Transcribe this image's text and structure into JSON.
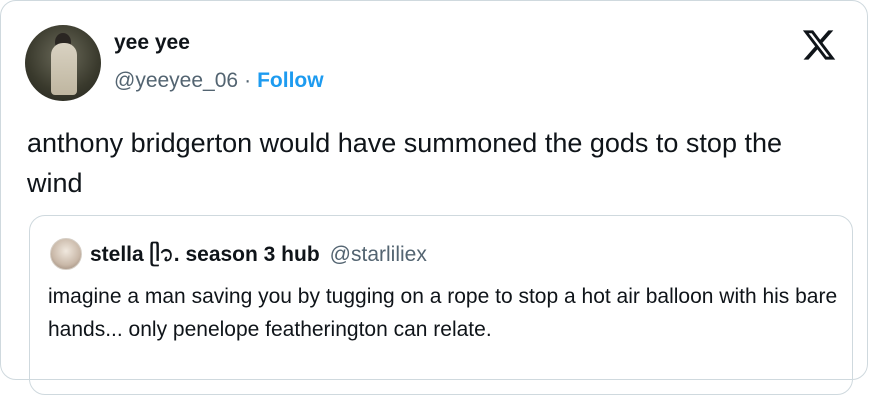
{
  "author": {
    "display_name": "yee yee",
    "handle": "@yeeyee_06",
    "separator": "·",
    "follow_label": "Follow"
  },
  "icons": {
    "logo": "x-logo-icon"
  },
  "tweet": {
    "text": "anthony bridgerton would have summoned the gods to stop the wind"
  },
  "quoted_tweet": {
    "display_name": "stella ᥫ᭡. season 3 hub",
    "handle": "@starliliex",
    "text": "imagine a man saving you by tugging on a rope to stop a hot air balloon with his bare hands... only penelope featherington can relate."
  },
  "colors": {
    "link": "#1d9bf0",
    "secondary_text": "#536471",
    "border": "#cfd9de"
  }
}
